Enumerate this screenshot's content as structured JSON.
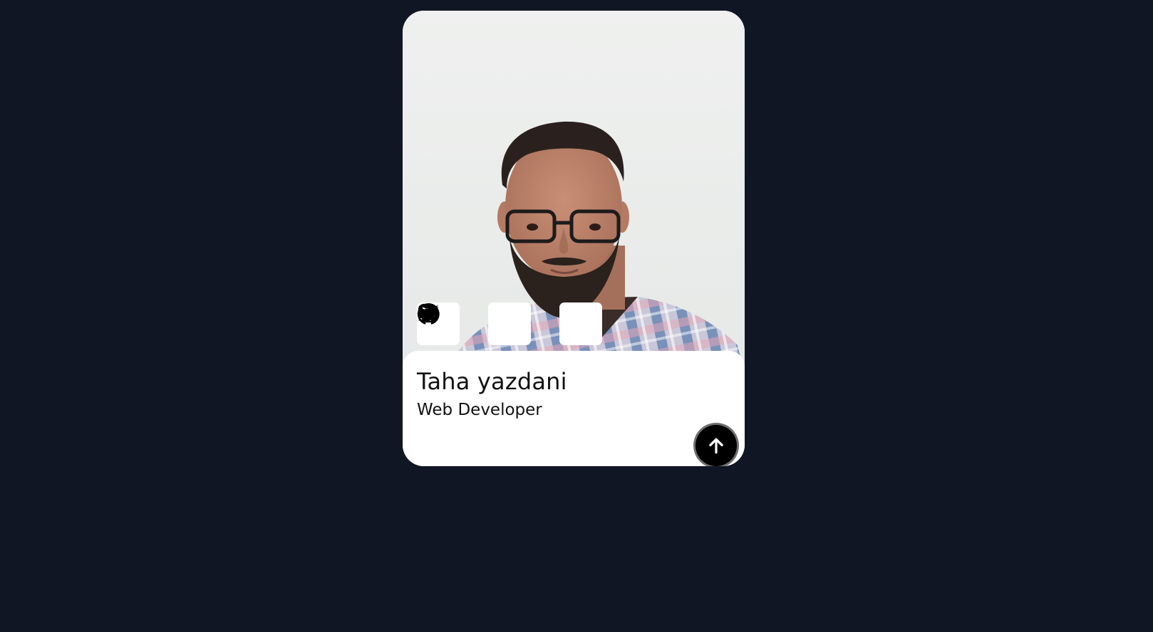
{
  "profile": {
    "name": "Taha yazdani",
    "role": "Web Developer",
    "photo_alt": "Taha yazdani"
  },
  "socials": [
    {
      "icon": "instagram-icon"
    },
    {
      "icon": "twitter-icon"
    },
    {
      "icon": "github-icon"
    }
  ],
  "actions": {
    "expand_icon": "arrow-up-icon"
  },
  "colors": {
    "page_background": "#111624",
    "card_background": "#ffffff",
    "button_background": "#000000",
    "text": "#111111"
  }
}
